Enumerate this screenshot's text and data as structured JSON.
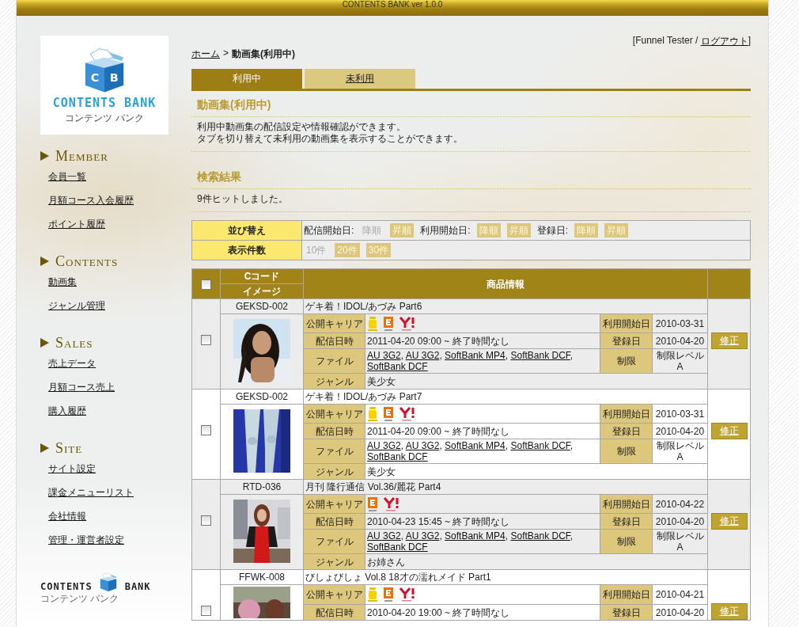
{
  "top_bar": {
    "title": "CONTENTS BANK ver 1.0.0"
  },
  "sidebar": {
    "logo": {
      "letters": [
        "C",
        "B"
      ],
      "name": "CONTENTS BANK",
      "kana": "コンテンツ バンク"
    },
    "sections": [
      {
        "title": "MEMBER",
        "items": [
          "会員一覧",
          "月額コース入会履歴",
          "ポイント履歴"
        ]
      },
      {
        "title": "CONTENTS",
        "items": [
          "動画集",
          "ジャンル管理"
        ]
      },
      {
        "title": "SALES",
        "items": [
          "売上データ",
          "月額コース売上",
          "購入履歴"
        ]
      },
      {
        "title": "SITE",
        "items": [
          "サイト設定",
          "課金メニューリスト",
          "会社情報",
          "管理・運営者設定"
        ]
      }
    ],
    "footer_logo": {
      "left": "CONTENTS",
      "right": "BANK",
      "kana": "コンテンツ バンク"
    }
  },
  "user": {
    "prefix": "[Funnel Tester /",
    "logout": "ログアウト",
    "suffix": "]"
  },
  "breadcrumb": {
    "home": "ホーム",
    "separator": ">",
    "current": "動画集(利用中)"
  },
  "tabs": [
    {
      "label": "利用中",
      "selected": true
    },
    {
      "label": "未利用",
      "selected": false
    }
  ],
  "intro": {
    "heading": "動画集(利用中)",
    "lines": [
      "利用中動画集の配信設定や情報確認ができます。",
      "タブを切り替えて未利用の動画集を表示することができます。"
    ]
  },
  "results": {
    "heading": "検索結果",
    "text": "9件ヒットしました。"
  },
  "sort": {
    "label": "並び替え",
    "groups": [
      {
        "label": "配信開始日:",
        "options": [
          {
            "label": "降順",
            "selected": true
          },
          {
            "label": "昇順",
            "selected": false
          }
        ]
      },
      {
        "label": "利用開始日:",
        "options": [
          {
            "label": "降順",
            "selected": false
          },
          {
            "label": "昇順",
            "selected": false
          }
        ]
      },
      {
        "label": "登録日:",
        "options": [
          {
            "label": "降順",
            "selected": false
          },
          {
            "label": "昇順",
            "selected": false
          }
        ]
      }
    ]
  },
  "page_size": {
    "label": "表示件数",
    "options": [
      {
        "label": "10件",
        "selected": true
      },
      {
        "label": "20件",
        "selected": false
      },
      {
        "label": "30件",
        "selected": false
      }
    ]
  },
  "table": {
    "select_all_checked": false,
    "columns": [
      "Cコード",
      "イメージ",
      "商品情報"
    ],
    "rows": [
      {
        "checked": false,
        "code": "GEKSD-002",
        "title": "ゲキ着！IDOL/あづみ Part6",
        "carrier": {
          "label": "公開キャリア",
          "icons": [
            {
              "kind": "imode"
            },
            {
              "kind": "ezweb"
            },
            {
              "kind": "yahoo"
            }
          ]
        },
        "start": {
          "label": "利用開始日",
          "value": "2010-03-31"
        },
        "delivery": {
          "label": "配信日時",
          "value": "2011-04-20 09:00 ~ 終了時間なし"
        },
        "registered": {
          "label": "登録日",
          "value": "2010-04-20"
        },
        "files": {
          "label": "ファイル",
          "separator": ",",
          "links": [
            "AU 3G2",
            "AU 3G2",
            "SoftBank MP4",
            "SoftBank DCF",
            "SoftBank DCF"
          ]
        },
        "limit": {
          "label": "制限",
          "value": "制限レベルA"
        },
        "genre": {
          "label": "ジャンル",
          "value": "美少女"
        },
        "edit": "修正"
      },
      {
        "checked": false,
        "code": "GEKSD-002",
        "title": "ゲキ着！IDOL/あづみ Part7",
        "carrier": {
          "label": "公開キャリア",
          "icons": [
            {
              "kind": "imode"
            },
            {
              "kind": "ezweb"
            },
            {
              "kind": "yahoo"
            }
          ]
        },
        "start": {
          "label": "利用開始日",
          "value": "2010-03-31"
        },
        "delivery": {
          "label": "配信日時",
          "value": "2011-04-20 09:00 ~ 終了時間なし"
        },
        "registered": {
          "label": "登録日",
          "value": "2010-04-20"
        },
        "files": {
          "label": "ファイル",
          "separator": ",",
          "links": [
            "AU 3G2",
            "AU 3G2",
            "SoftBank MP4",
            "SoftBank DCF",
            "SoftBank DCF"
          ]
        },
        "limit": {
          "label": "制限",
          "value": "制限レベルA"
        },
        "genre": {
          "label": "ジャンル",
          "value": "美少女"
        },
        "edit": "修正"
      },
      {
        "checked": false,
        "code": "RTD-036",
        "title": "月刊 隆行通信 Vol.36/麗花 Part4",
        "carrier": {
          "label": "公開キャリア",
          "icons": [
            {
              "kind": "ezweb"
            },
            {
              "kind": "yahoo"
            }
          ]
        },
        "start": {
          "label": "利用開始日",
          "value": "2010-04-22"
        },
        "delivery": {
          "label": "配信日時",
          "value": "2010-04-23 15:45 ~ 終了時間なし"
        },
        "registered": {
          "label": "登録日",
          "value": "2010-04-20"
        },
        "files": {
          "label": "ファイル",
          "separator": ",",
          "links": [
            "AU 3G2",
            "AU 3G2",
            "SoftBank MP4",
            "SoftBank DCF",
            "SoftBank DCF"
          ]
        },
        "limit": {
          "label": "制限",
          "value": "制限レベルA"
        },
        "genre": {
          "label": "ジャンル",
          "value": "お姉さん"
        },
        "edit": "修正"
      },
      {
        "checked": false,
        "code": "FFWK-008",
        "title": "びしょびしょ Vol.8 18才の濡れメイド Part1",
        "carrier": {
          "label": "公開キャリア",
          "icons": [
            {
              "kind": "imode"
            },
            {
              "kind": "ezweb"
            },
            {
              "kind": "yahoo"
            }
          ]
        },
        "start": {
          "label": "利用開始日",
          "value": "2010-04-21"
        },
        "delivery": {
          "label": "配信日時",
          "value": "2010-04-20 19:00 ~ 終了時間なし"
        },
        "registered": {
          "label": "登録日",
          "value": "2010-04-20"
        },
        "edit": "修正"
      }
    ]
  }
}
